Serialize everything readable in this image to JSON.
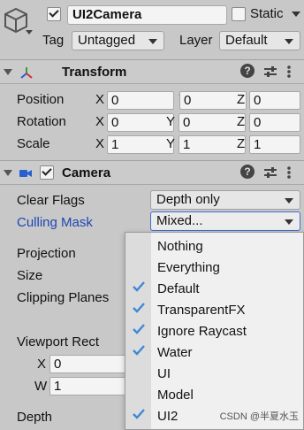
{
  "colors": {
    "panel_bg": "#c8c8c8",
    "link_blue": "#1e46b4",
    "check_blue": "#3d88d4",
    "popup_bg": "#f0f0f0"
  },
  "object": {
    "active": true,
    "name": "UI2Camera",
    "static_label": "Static",
    "static_checked": false,
    "tag_label": "Tag",
    "tag_value": "Untagged",
    "layer_label": "Layer",
    "layer_value": "Default"
  },
  "transform": {
    "title": "Transform",
    "axes": [
      "X",
      "Y",
      "Z"
    ],
    "rows": [
      {
        "label": "Position",
        "values": [
          "0",
          "0",
          "0"
        ]
      },
      {
        "label": "Rotation",
        "values": [
          "0",
          "0",
          "0"
        ]
      },
      {
        "label": "Scale",
        "values": [
          "1",
          "1",
          "1"
        ]
      }
    ]
  },
  "camera": {
    "title": "Camera",
    "enabled": true,
    "clear_flags_label": "Clear Flags",
    "clear_flags_value": "Depth only",
    "culling_mask_label": "Culling Mask",
    "culling_mask_value": "Mixed...",
    "projection_label": "Projection",
    "size_label": "Size",
    "clipping_planes_label": "Clipping Planes",
    "viewport_rect_label": "Viewport Rect",
    "viewport_x_label": "X",
    "viewport_x_value": "0",
    "viewport_w_label": "W",
    "viewport_w_value": "1",
    "depth_label": "Depth"
  },
  "culling_menu": {
    "items": [
      {
        "label": "Nothing",
        "checked": false
      },
      {
        "label": "Everything",
        "checked": false
      },
      {
        "label": "Default",
        "checked": true
      },
      {
        "label": "TransparentFX",
        "checked": true
      },
      {
        "label": "Ignore Raycast",
        "checked": true
      },
      {
        "label": "Water",
        "checked": true
      },
      {
        "label": "UI",
        "checked": false
      },
      {
        "label": "Model",
        "checked": false
      },
      {
        "label": "UI2",
        "checked": true
      }
    ]
  },
  "icons": {
    "gameobject": "cube-icon",
    "transform": "transform-axes-icon",
    "camera": "camera-icon",
    "help": "help-icon",
    "presets": "presets-icon",
    "menu": "kebab-menu-icon"
  },
  "watermark": "CSDN @半夏水玉"
}
